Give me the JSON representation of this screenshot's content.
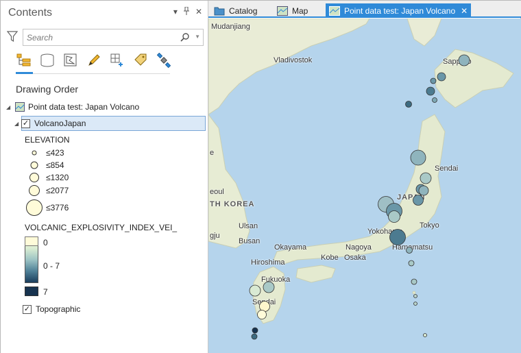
{
  "contents_pane": {
    "title": "Contents",
    "controls": {
      "menu": "▾",
      "pin": "📌",
      "close": "✕"
    },
    "search_placeholder": "Search",
    "drawing_order_label": "Drawing Order",
    "map_item_label": "Point data test: Japan Volcano",
    "layer_label": "VolcanoJapan",
    "elevation_title": "ELEVATION",
    "elevation_classes": [
      "≤423",
      "≤854",
      "≤1320",
      "≤2077",
      "≤3776"
    ],
    "vei_title": "VOLCANIC_EXPLOSIVITY_INDEX_VEI_",
    "vei_ramp_labels": {
      "top": "0",
      "middle": "0 - 7",
      "bottom": "7"
    },
    "basemap_label": "Topographic"
  },
  "tabs": [
    {
      "label": "Catalog"
    },
    {
      "label": "Map"
    },
    {
      "label": "Point data test: Japan Volcano"
    }
  ],
  "map_labels": {
    "mudanjiang": "Mudanjiang",
    "vladivostok": "Vladivostok",
    "sapporo": "Sapporo",
    "sendai": "Sendai",
    "japan": "JAPAN",
    "seoul": "eoul",
    "north_korea": "TH KOREA",
    "ulsan": "Ulsan",
    "gju": "gju",
    "busan": "Busan",
    "okayama": "Okayama",
    "nagoya": "Nagoya",
    "yokohama": "Yokohama",
    "tokyo": "Tokyo",
    "kobe": "Kobe",
    "osaka": "Osaka",
    "hamamatsu": "Hamamatsu",
    "hiroshima": "Hiroshima",
    "fukuoka": "Fukuoka",
    "sendai_kyushu": "Sendai",
    "left_edge_e": "e"
  },
  "colors": {
    "accent": "#2f8ad8",
    "water": "#b5d4ec",
    "land": "#e7ecd4",
    "vei_low": "#fffbd9",
    "vei_high": "#17334f"
  }
}
